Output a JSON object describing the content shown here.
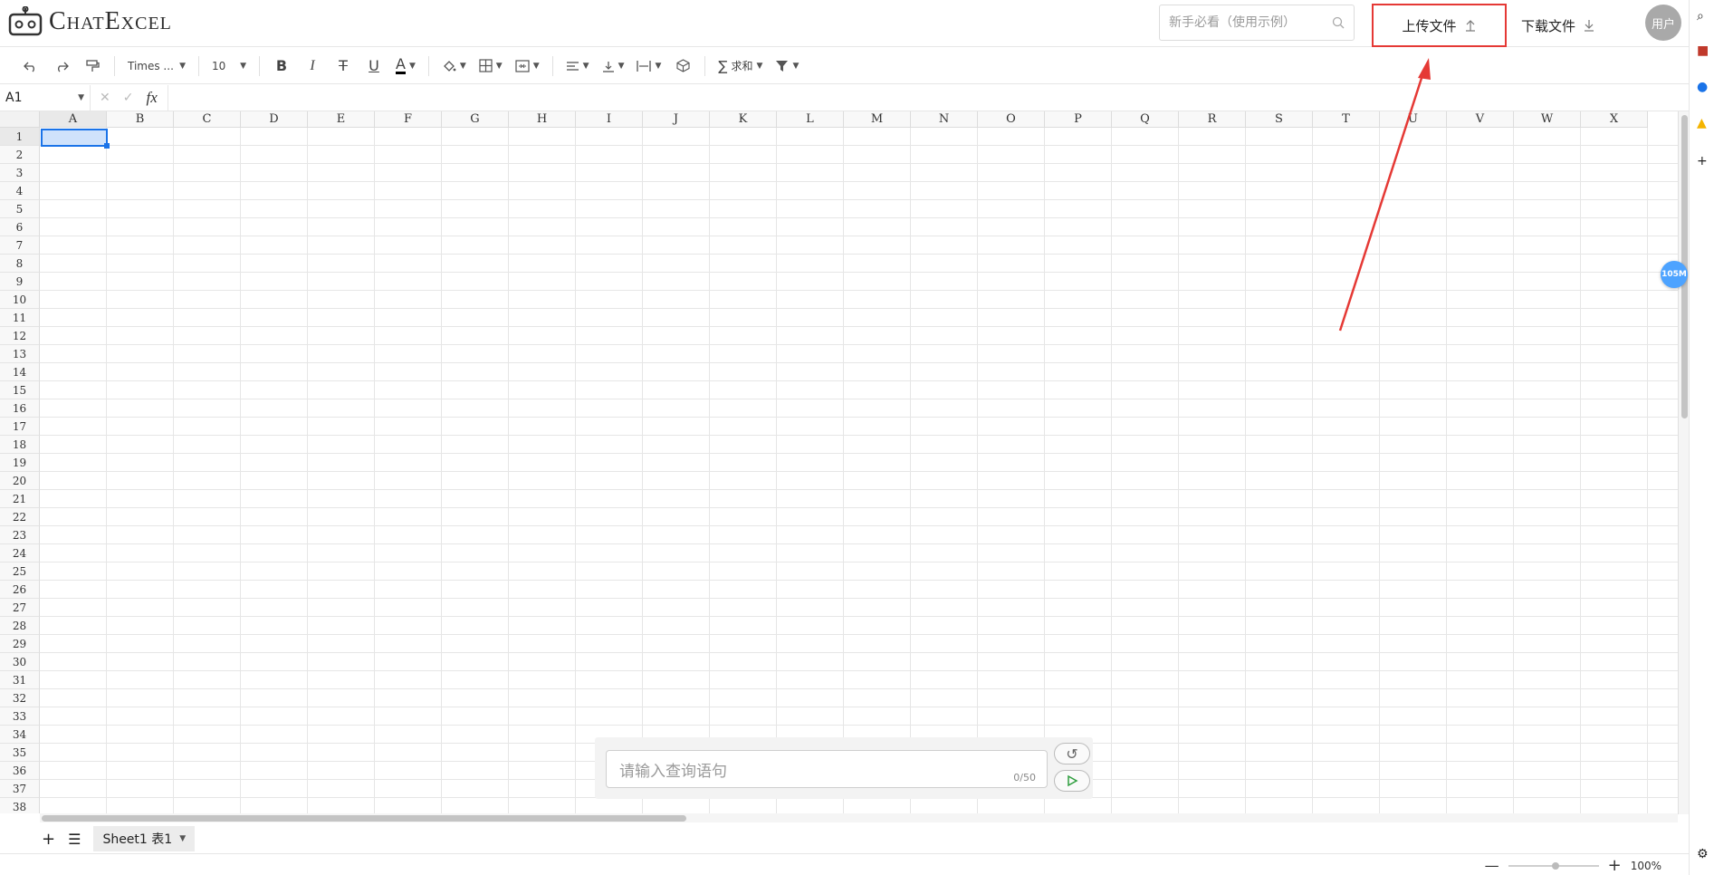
{
  "header": {
    "logo_text": "ChatExcel",
    "search_placeholder": "新手必看（使用示例）",
    "upload_label": "上传文件",
    "download_label": "下载文件",
    "avatar_label": "用户"
  },
  "toolbar": {
    "font_name": "Times ...",
    "font_size": "10",
    "sum_label": "求和"
  },
  "formula_bar": {
    "cell_ref": "A1",
    "fx_label": "fx"
  },
  "grid": {
    "columns": [
      "A",
      "B",
      "C",
      "D",
      "E",
      "F",
      "G",
      "H",
      "I",
      "J",
      "K",
      "L",
      "M",
      "N",
      "O",
      "P",
      "Q",
      "R",
      "S",
      "T",
      "U",
      "V",
      "W",
      "X"
    ],
    "rows": [
      "1",
      "2",
      "3",
      "4",
      "5",
      "6",
      "7",
      "8",
      "9",
      "10",
      "11",
      "12",
      "13",
      "14",
      "15",
      "16",
      "17",
      "18",
      "19",
      "20",
      "21",
      "22",
      "23",
      "24",
      "25",
      "26",
      "27",
      "28",
      "29",
      "30",
      "31",
      "32",
      "33",
      "34",
      "35",
      "36",
      "37",
      "38"
    ],
    "active_cell": "A1"
  },
  "badge": "105M",
  "query": {
    "placeholder": "请输入查询语句",
    "count": "0/50"
  },
  "sheets": [
    {
      "label": "Sheet1 表1"
    }
  ],
  "footer": {
    "zoom": "100%"
  },
  "colors": {
    "accent": "#1a73e8",
    "highlight_red": "#e53935",
    "badge_blue": "#4da3ff"
  }
}
